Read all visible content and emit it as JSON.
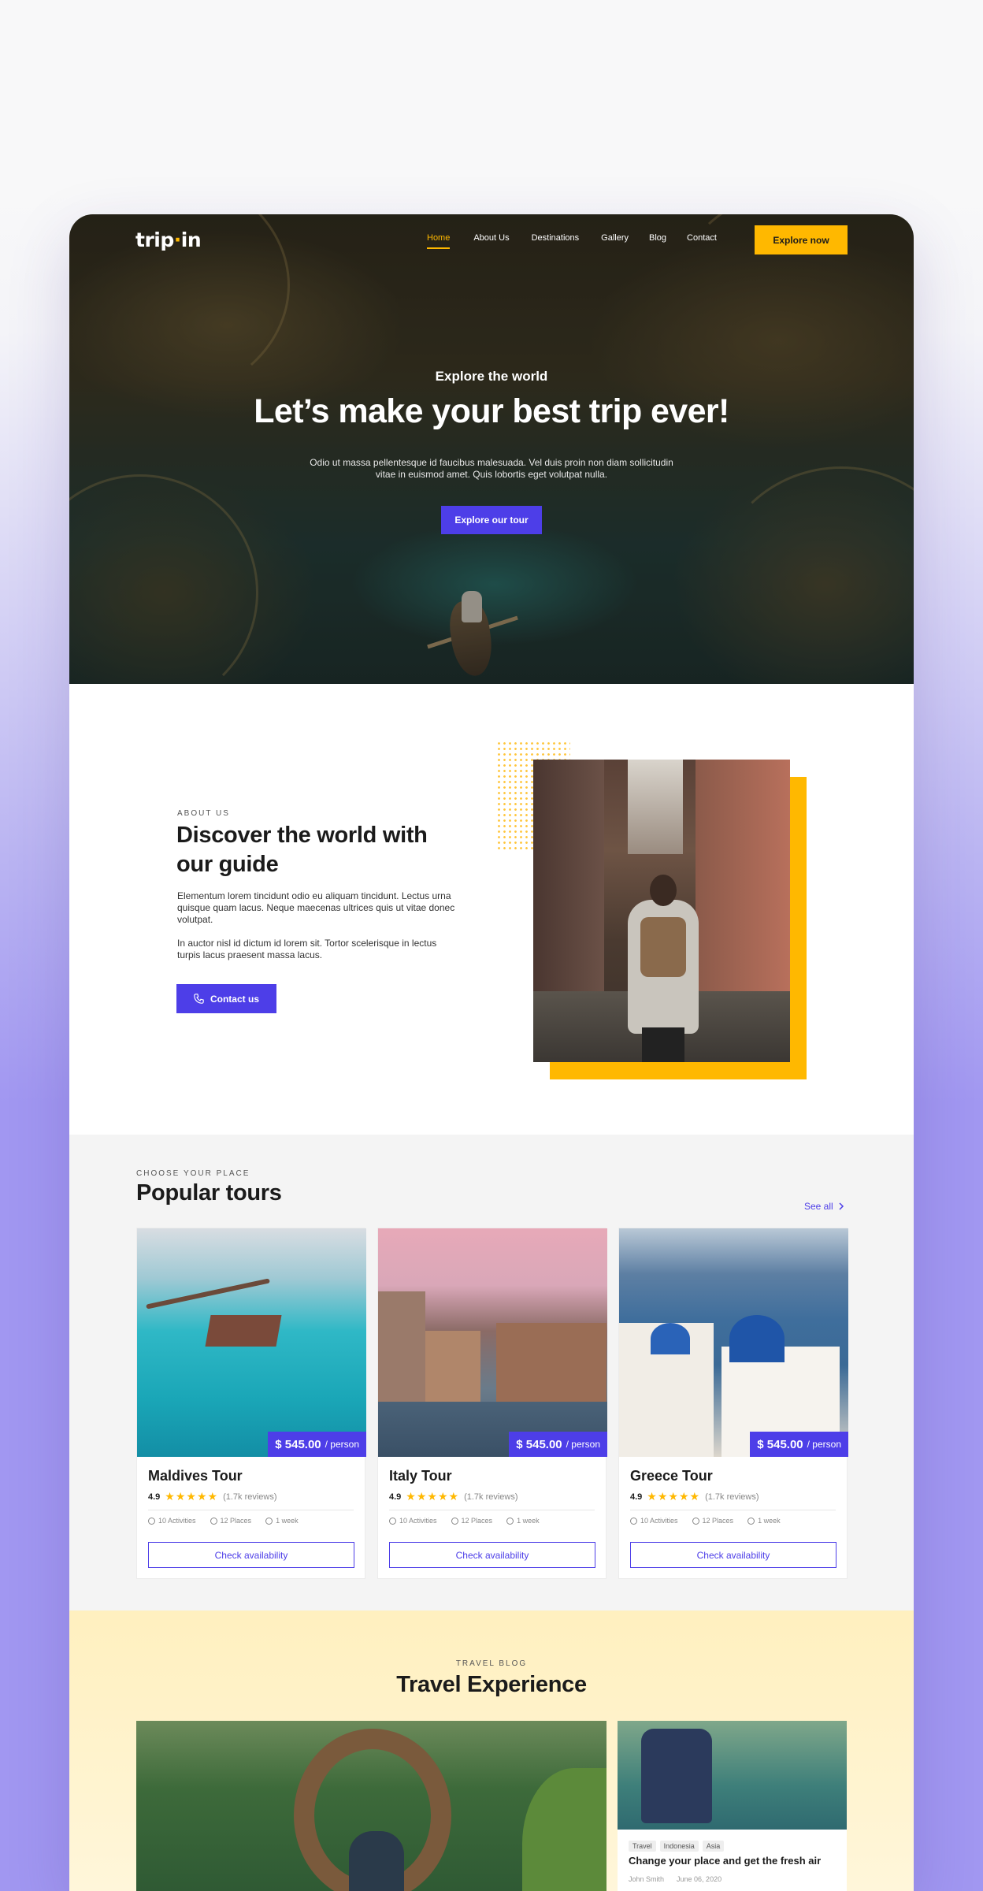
{
  "brand": {
    "logo_left": "trip",
    "logo_dot": "·",
    "logo_right": "in"
  },
  "nav": {
    "items": [
      {
        "label": "Home",
        "active": true
      },
      {
        "label": "About Us"
      },
      {
        "label": "Destinations"
      },
      {
        "label": "Gallery"
      },
      {
        "label": "Blog"
      },
      {
        "label": "Contact"
      }
    ],
    "cta": "Explore now"
  },
  "hero": {
    "eyebrow": "Explore the world",
    "title": "Let’s make your best trip ever!",
    "description": "Odio ut massa pellentesque id faucibus malesuada. Vel duis proin non diam sollicitudin vitae in euismod amet. Quis lobortis eget volutpat nulla.",
    "cta": "Explore our tour"
  },
  "about": {
    "eyebrow": "ABOUT US",
    "title": "Discover the world with our guide",
    "paragraph1": "Elementum lorem tincidunt odio eu aliquam tincidunt. Lectus urna quisque quam lacus. Neque maecenas ultrices quis ut vitae donec volutpat.",
    "paragraph2": "In auctor nisl id dictum id lorem sit. Tortor scelerisque in lectus turpis lacus praesent massa lacus.",
    "cta": "Contact us"
  },
  "tours": {
    "eyebrow": "CHOOSE YOUR PLACE",
    "title": "Popular tours",
    "see_all": "See all",
    "items": [
      {
        "name": "Maldives Tour",
        "price": "$ 545.00",
        "per": "/ person",
        "rating": "4.9",
        "stars": "★★★★★",
        "reviews": "(1.7k reviews)",
        "activities": "10 Activities",
        "places": "12 Places",
        "duration": "1 week",
        "cta": "Check availability"
      },
      {
        "name": "Italy Tour",
        "price": "$ 545.00",
        "per": "/ person",
        "rating": "4.9",
        "stars": "★★★★★",
        "reviews": "(1.7k reviews)",
        "activities": "10 Activities",
        "places": "12 Places",
        "duration": "1 week",
        "cta": "Check availability"
      },
      {
        "name": "Greece Tour",
        "price": "$ 545.00",
        "per": "/ person",
        "rating": "4.9",
        "stars": "★★★★★",
        "reviews": "(1.7k reviews)",
        "activities": "10 Activities",
        "places": "12 Places",
        "duration": "1 week",
        "cta": "Check availability"
      }
    ]
  },
  "blog": {
    "eyebrow": "TRAVEL BLOG",
    "title": "Travel Experience",
    "small_post": {
      "tags": [
        "Travel",
        "Indonesia",
        "Asia"
      ],
      "title": "Change your place and get the fresh air",
      "author": "John Smith",
      "date": "June 06, 2020"
    }
  },
  "colors": {
    "accent": "#4d3ee8",
    "highlight": "#ffb800",
    "text": "#1b1b1b"
  }
}
